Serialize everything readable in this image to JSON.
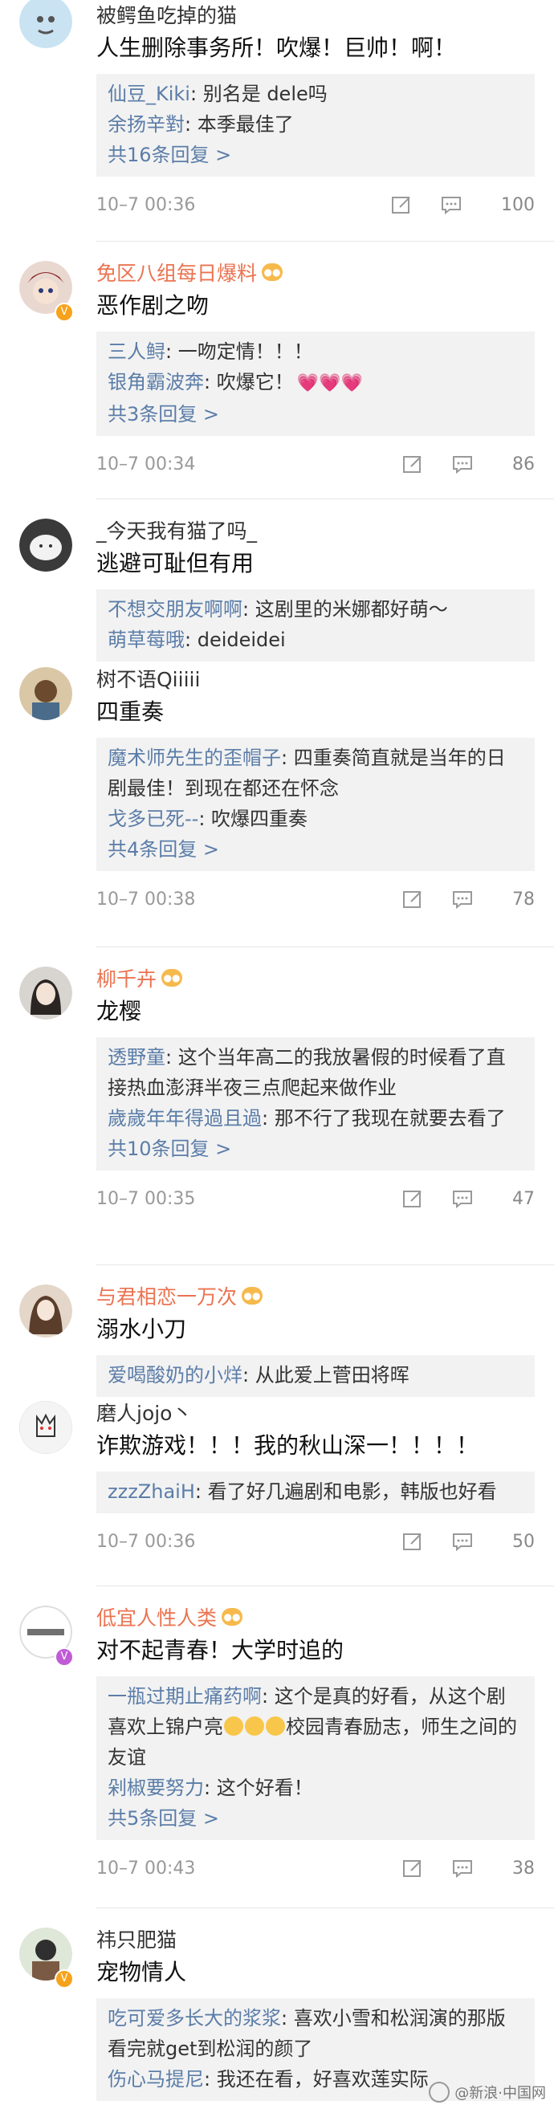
{
  "comments": [
    {
      "name": "被鳄鱼吃掉的猫",
      "text": "人生删除事务所！吹爆！巨帅！啊！",
      "replies": [
        {
          "who": "仙豆_Kiki",
          "text": ": 别名是 dele吗"
        },
        {
          "who": "余扬辛對",
          "text": ": 本季最佳了"
        }
      ],
      "more": "共16条回复 >",
      "time": "10–7 00:36",
      "likes": "100"
    },
    {
      "name": "免区八组每日爆料",
      "text": "恶作剧之吻",
      "replies": [
        {
          "who": "三人鲟",
          "text": ": 一吻定情！！！"
        },
        {
          "who": "银角霸波奔",
          "text": ": 吹爆它！"
        }
      ],
      "more": "共3条回复 >",
      "time": "10–7 00:34",
      "likes": "86"
    },
    {
      "name": "_今天我有猫了吗_",
      "text": "逃避可耻但有用",
      "replies": [
        {
          "who": "不想交朋友啊啊",
          "text": ": 这剧里的米娜都好萌～"
        },
        {
          "who": "萌草莓哦",
          "text": ": deideidei"
        }
      ]
    },
    {
      "name": "树不语Qiiiii",
      "text": "四重奏",
      "replies": [
        {
          "who": "魔术师先生的歪帽子",
          "text": ": 四重奏简直就是当年的日剧最佳！到现在都还在怀念"
        },
        {
          "who": "戈多已死--",
          "text": ": 吹爆四重奏"
        }
      ],
      "more": "共4条回复 >",
      "time": "10–7 00:38",
      "likes": "78"
    },
    {
      "name": "柳千卉",
      "text": "龙樱",
      "replies": [
        {
          "who": "透野童",
          "text": ": 这个当年高二的我放暑假的时候看了直接热血澎湃半夜三点爬起来做作业"
        },
        {
          "who": "歲歲年年得過且過",
          "text": ": 那不行了我现在就要去看了"
        }
      ],
      "more": "共10条回复 >",
      "time": "10–7 00:35",
      "likes": "47"
    },
    {
      "name": "与君相恋一万次",
      "text": "溺水小刀",
      "replies": [
        {
          "who": "爱喝酸奶的小烊",
          "text": ": 从此爱上菅田将晖"
        }
      ]
    },
    {
      "name": "磨人jojo丶",
      "text": "诈欺游戏！！！我的秋山深一！！！！",
      "replies": [
        {
          "who": "zzzZhaiH",
          "text": ": 看了好几遍剧和电影，韩版也好看"
        }
      ],
      "time": "10–7 00:36",
      "likes": "50"
    },
    {
      "name": "低宜人性人类",
      "text": "对不起青春！大学时追的",
      "replies": [
        {
          "who": "一瓶过期止痛药啊",
          "text": ": 这个是真的好看，从这个剧喜欢上锦户亮"
        },
        {
          "who": "剁椒要努力",
          "text": ": 这个好看！"
        }
      ],
      "reply1_tail": "校园青春励志，师生之间的友谊",
      "more": "共5条回复 >",
      "time": "10–7 00:43",
      "likes": "38"
    },
    {
      "name": "祎只肥猫",
      "text": "宠物情人",
      "replies": [
        {
          "who": "吃可爱多长大的浆浆",
          "text": ": 喜欢小雪和松润演的那版 看完就get到松润的颜了"
        },
        {
          "who": "伤心马提尼",
          "text": ": 我还在看，好喜欢莲"
        }
      ],
      "last_reply_tail": "实际"
    }
  ],
  "watermark": "@新浪·中国网"
}
